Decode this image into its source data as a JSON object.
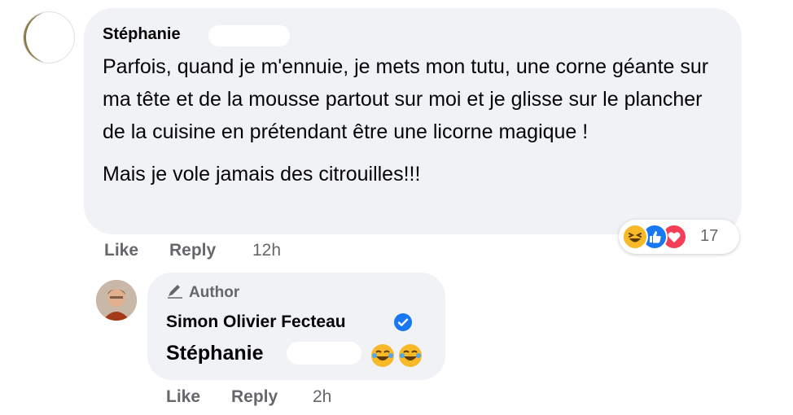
{
  "comment": {
    "author": "Stéphanie",
    "paragraphs": [
      "Parfois, quand je m'ennuie, je mets mon tutu, une corne géante sur ma tête et de la mousse partout sur moi et je glisse sur le plancher de la cuisine en prétendant être une licorne magique !",
      "Mais je vole jamais des citrouilles!!!"
    ],
    "actions": {
      "like": "Like",
      "reply": "Reply",
      "time": "12h"
    },
    "reactions": {
      "icons": [
        "haha-icon",
        "like-icon",
        "love-icon"
      ],
      "count": "17"
    }
  },
  "reply": {
    "badge": "Author",
    "author": "Simon Olivier Fecteau",
    "verified": true,
    "mention": "Stéphanie",
    "emojis": [
      "tears-of-joy-icon",
      "tears-of-joy-icon"
    ],
    "actions": {
      "like": "Like",
      "reply": "Reply",
      "time": "2h"
    }
  },
  "colors": {
    "bubble": "#f0f2f5",
    "secondary_text": "#65676b",
    "verified": "#1877f2",
    "love": "#f33e58",
    "haha": "#f7b928"
  }
}
